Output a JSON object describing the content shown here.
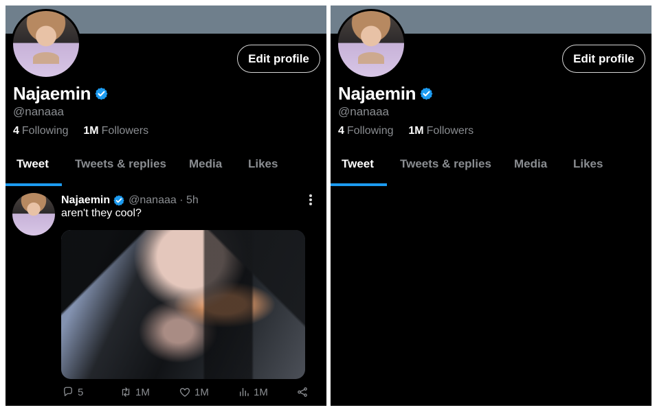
{
  "profile": {
    "edit_label": "Edit profile",
    "name": "Najaemin",
    "handle": "@nanaaa",
    "following_count": "4",
    "following_label": "Following",
    "followers_count": "1M",
    "followers_label": "Followers"
  },
  "tabs": [
    {
      "label": "Tweet"
    },
    {
      "label": "Tweets & replies"
    },
    {
      "label": "Media"
    },
    {
      "label": "Likes"
    }
  ],
  "tweet": {
    "author": "Najaemin",
    "meta": "@nanaaa · 5h",
    "text": "aren't they cool?",
    "replies": "5",
    "retweets": "1M",
    "likes": "1M",
    "views": "1M"
  },
  "colors": {
    "accent": "#1d9bf0",
    "banner": "#6f7f8c",
    "background": "#000000"
  }
}
